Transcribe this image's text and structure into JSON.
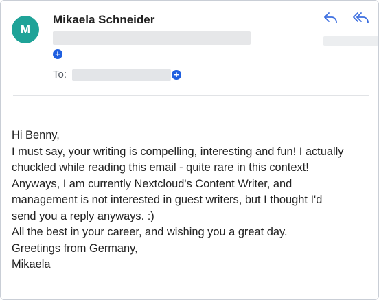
{
  "message": {
    "sender": {
      "initial": "M",
      "name": "Mikaela Schneider",
      "avatar_color": "#1fa398"
    },
    "to_label": "To:",
    "actions": {
      "reply_icon": "reply-icon",
      "reply_all_icon": "reply-all-icon"
    },
    "body_lines": [
      "Hi Benny,",
      "I must say, your writing is compelling, interesting and fun! I actually",
      "chuckled while reading this email - quite rare in this context!",
      "Anyways, I am currently Nextcloud's Content Writer, and",
      "management is not interested in guest writers, but I thought I'd",
      "send you a reply anyways. :)",
      "All the best in your career, and wishing you a great day.",
      "Greetings from Germany,",
      "Mikaela"
    ]
  },
  "colors": {
    "accent": "#1f5fe0",
    "avatar": "#1fa398",
    "text": "#222222"
  }
}
